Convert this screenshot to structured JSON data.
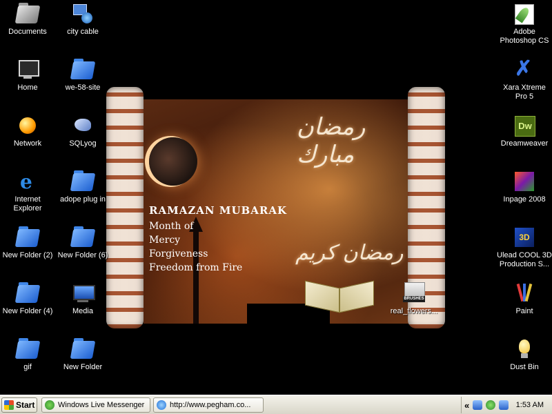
{
  "desktop": {
    "icons_left": [
      {
        "label": "Documents",
        "icon": "documents-folder-icon"
      },
      {
        "label": "city cable",
        "icon": "network-connection-icon"
      },
      {
        "label": "Home",
        "icon": "home-computer-icon"
      },
      {
        "label": "we-58-site",
        "icon": "folder-icon"
      },
      {
        "label": "Network",
        "icon": "network-globe-icon"
      },
      {
        "label": "SQLyog",
        "icon": "sqlyog-dolphin-icon"
      },
      {
        "label": "Internet Explorer",
        "icon": "internet-explorer-icon"
      },
      {
        "label": "adope plug in",
        "icon": "folder-icon"
      },
      {
        "label": "New Folder (2)",
        "icon": "folder-icon"
      },
      {
        "label": "New Folder (6)",
        "icon": "folder-icon"
      },
      {
        "label": "New Folder (4)",
        "icon": "folder-icon"
      },
      {
        "label": "Media",
        "icon": "media-monitor-icon"
      },
      {
        "label": "gif",
        "icon": "folder-icon"
      },
      {
        "label": "New Folder",
        "icon": "folder-icon"
      }
    ],
    "icons_right": [
      {
        "label": "Adobe Photoshop CS",
        "icon": "photoshop-feather-icon"
      },
      {
        "label": "Xara Xtreme Pro 5",
        "icon": "xara-icon"
      },
      {
        "label": "Dreamweaver",
        "icon": "dreamweaver-icon"
      },
      {
        "label": "Inpage 2008",
        "icon": "inpage-icon"
      },
      {
        "label": "Ulead COOL 3D Production S...",
        "icon": "ulead-cool3d-icon"
      },
      {
        "label": "Paint",
        "icon": "paint-brushes-icon"
      },
      {
        "label": "Dust Bin",
        "icon": "recycle-bin-icon"
      }
    ],
    "floating_icon": {
      "label": "real_flowers...",
      "icon": "brushes-file-icon",
      "badge": "BRUSHES"
    }
  },
  "wallpaper": {
    "title": "RAMAZAN MUBARAK",
    "lines": [
      "Month of",
      "Mercy",
      "Forgiveness",
      "Freedom from Fire"
    ],
    "calligraphy_top": "رمضان مبارك",
    "calligraphy_bottom": "رمضان كريم"
  },
  "taskbar": {
    "start_label": "Start",
    "tasks": [
      {
        "label": "Windows Live Messenger",
        "icon": "messenger-icon"
      },
      {
        "label": "http://www.pegham.co...",
        "icon": "internet-explorer-icon"
      }
    ],
    "tray_chevron": "«",
    "clock": "1:53 AM"
  },
  "colors": {
    "taskbar": "#ece9d8",
    "desktop": "#000000",
    "folder": "#2f74e0",
    "wallpaper_accent": "#c86a2c"
  }
}
